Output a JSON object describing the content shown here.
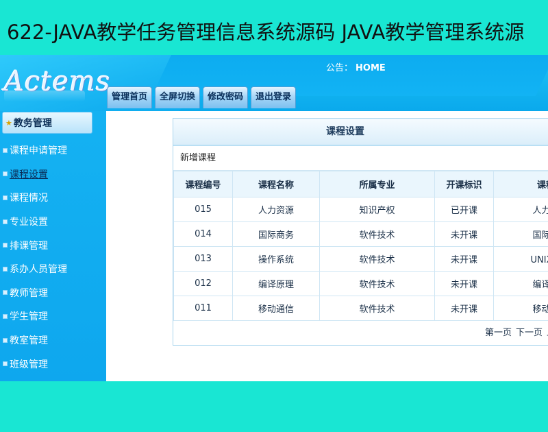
{
  "page_banner": "622-JAVA教学任务管理信息系统源码 JAVA教学管理系统源",
  "header": {
    "logo": "Actems",
    "notice_label": "公告：",
    "notice_value": "HOME",
    "nav": [
      "管理首页",
      "全屏切换",
      "修改密码",
      "退出登录"
    ]
  },
  "sidebar": {
    "heading": "教务管理",
    "items": [
      "课程申请管理",
      "课程设置",
      "课程情况",
      "专业设置",
      "排课管理",
      "系办人员管理",
      "教师管理",
      "学生管理",
      "教室管理",
      "班级管理"
    ],
    "active_index": 1
  },
  "panel": {
    "title": "课程设置",
    "new_link": "新增课程",
    "columns": [
      "课程编号",
      "课程名称",
      "所属专业",
      "开课标识",
      "课程"
    ],
    "rows": [
      [
        "015",
        "人力资源",
        "知识产权",
        "已开课",
        "人力资"
      ],
      [
        "014",
        "国际商务",
        "软件技术",
        "未开课",
        "国际商"
      ],
      [
        "013",
        "操作系统",
        "软件技术",
        "未开课",
        "UNIX操"
      ],
      [
        "012",
        "编译原理",
        "软件技术",
        "未开课",
        "编译原"
      ],
      [
        "011",
        "移动通信",
        "软件技术",
        "未开课",
        "移动通"
      ]
    ],
    "pager": [
      "第一页",
      "下一页",
      "上"
    ]
  },
  "colors": {
    "banner_bg": "#19e6d3",
    "header_blue": "#0aa9ec",
    "sidebar_blue": "#12adf0",
    "table_border": "#cfe6f4"
  }
}
